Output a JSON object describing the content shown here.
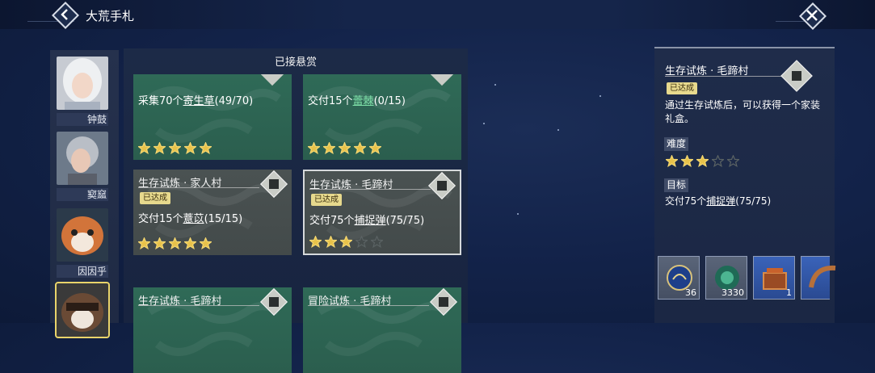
{
  "header": {
    "title": "大荒手札"
  },
  "portraits": [
    {
      "name": "钟鼓",
      "selected": false
    },
    {
      "name": "窫窳",
      "selected": false
    },
    {
      "name": "因因乎",
      "selected": false
    },
    {
      "name": "",
      "selected": true
    }
  ],
  "panel": {
    "title": "已接悬赏",
    "cards": [
      {
        "title": "",
        "badge": "",
        "text_prefix": "采集70个",
        "text_item": "寄生草",
        "text_suffix": "(49/70)",
        "stars_filled": 5,
        "style": "green"
      },
      {
        "title": "",
        "badge": "",
        "text_prefix": "交付15个",
        "text_item": "蕾棘",
        "text_suffix": "(0/15)",
        "stars_filled": 5,
        "style": "green"
      },
      {
        "title": "生存试炼 · 家人村",
        "badge": "已达成",
        "text_prefix": "交付15个",
        "text_item": "薏苡",
        "text_suffix": "(15/15)",
        "stars_filled": 5,
        "style": "gray"
      },
      {
        "title": "生存试炼 · 毛蹄村",
        "badge": "已达成",
        "text_prefix": "交付75个",
        "text_item": "捕捉弹",
        "text_suffix": "(75/75)",
        "stars_filled": 3,
        "style": "gray"
      },
      {
        "title": "生存试炼 · 毛蹄村",
        "badge": "",
        "text_prefix": "",
        "text_item": "",
        "text_suffix": "",
        "stars_filled": 0,
        "style": "green"
      },
      {
        "title": "冒险试炼 · 毛蹄村",
        "badge": "",
        "text_prefix": "",
        "text_item": "",
        "text_suffix": "",
        "stars_filled": 0,
        "style": "green"
      }
    ]
  },
  "detail": {
    "title": "生存试炼 · 毛蹄村",
    "badge": "已达成",
    "description": "通过生存试炼后，可以获得一个家装礼盒。",
    "difficulty_label": "难度",
    "difficulty_stars": 3,
    "difficulty_max": 5,
    "target_label": "目标",
    "target_prefix": "交付75个",
    "target_item": "捕捉弹",
    "target_suffix": "(75/75)",
    "rewards": [
      {
        "count": "36",
        "icon": "dragon-coin-icon",
        "style": "gray"
      },
      {
        "count": "3330",
        "icon": "jade-orb-icon",
        "style": "gray"
      },
      {
        "count": "1",
        "icon": "furniture-chest-icon",
        "style": "blue"
      },
      {
        "count": "",
        "icon": "horn-icon",
        "style": "blue"
      }
    ]
  },
  "colors": {
    "badge": "#e7d98d",
    "star_gold": "#e8c24a",
    "card_green": "#2f6a57",
    "card_gray": "#4a5252"
  }
}
